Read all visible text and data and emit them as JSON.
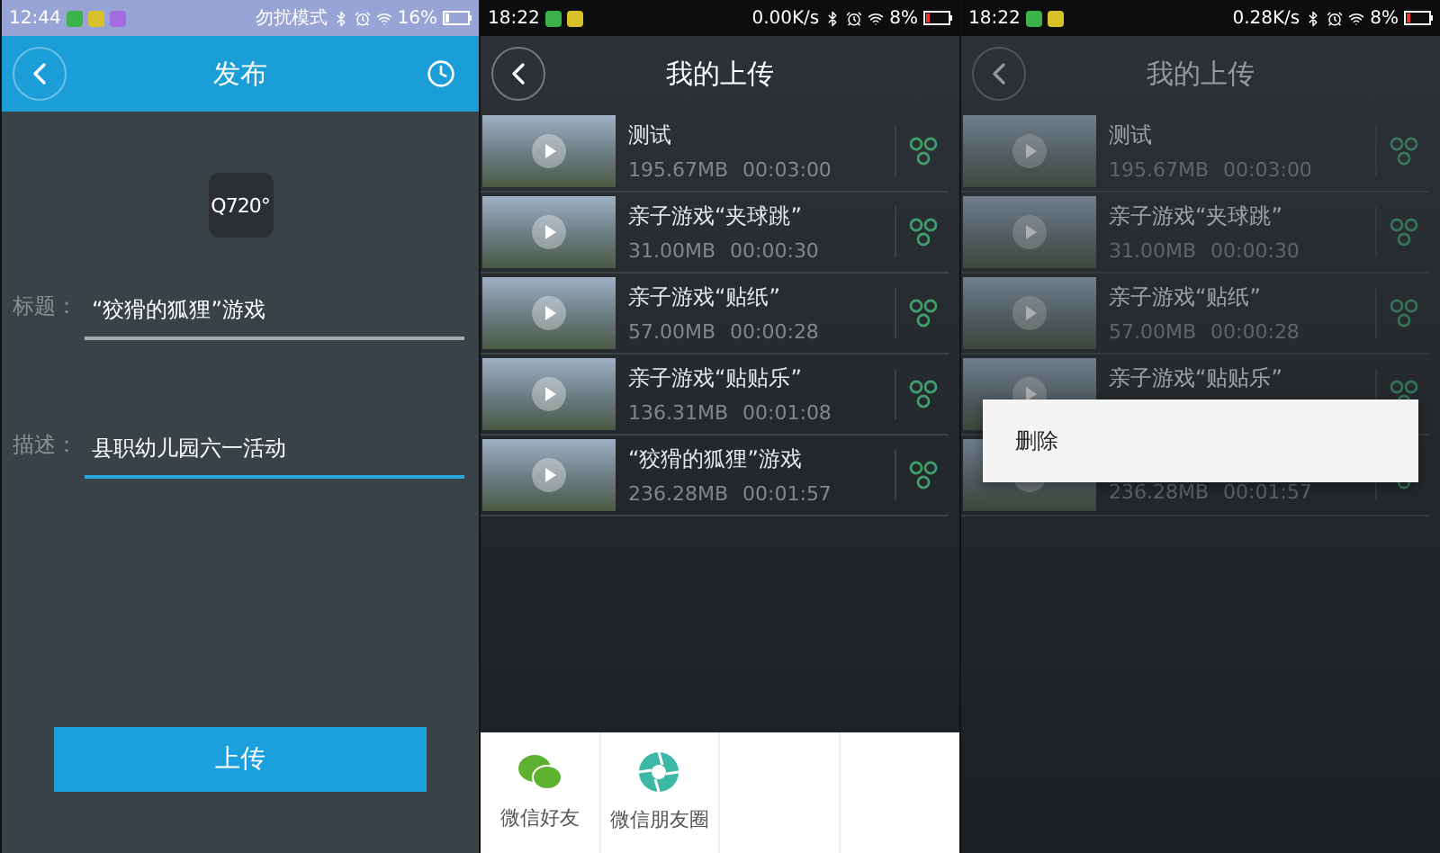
{
  "screens": [
    {
      "kind": "publish",
      "dimmed": false,
      "status_bar": {
        "time": "12:44",
        "mode_text": "勿扰模式",
        "battery": "16%"
      },
      "header": {
        "title": "发布"
      },
      "logo": {
        "text": "Q720°"
      },
      "fields": [
        {
          "label": "标题：",
          "value": "“狡猾的狐狸”游戏",
          "focused": false
        },
        {
          "label": "描述：",
          "value": "县职幼儿园六一活动",
          "focused": true
        }
      ],
      "button": "上传"
    },
    {
      "kind": "uploads",
      "dimmed": false,
      "status_bar": {
        "time": "18:22",
        "speed": "0.00K/s",
        "battery": "8%"
      },
      "header": {
        "title": "我的上传"
      },
      "videos": [
        {
          "title": "测试",
          "size": "195.67MB",
          "duration": "00:03:00"
        },
        {
          "title": "亲子游戏“夹球跳”",
          "size": "31.00MB",
          "duration": "00:00:30"
        },
        {
          "title": "亲子游戏“贴纸”",
          "size": "57.00MB",
          "duration": "00:00:28"
        },
        {
          "title": "亲子游戏“贴贴乐”",
          "size": "136.31MB",
          "duration": "00:01:08"
        },
        {
          "title": "“狡猾的狐狸”游戏",
          "size": "236.28MB",
          "duration": "00:01:57"
        }
      ],
      "share_sheet": [
        {
          "kind": "wechat",
          "label": "微信好友"
        },
        {
          "kind": "moments",
          "label": "微信朋友圈"
        },
        {
          "kind": "empty"
        },
        {
          "kind": "empty"
        }
      ]
    },
    {
      "kind": "uploads",
      "dimmed": true,
      "status_bar": {
        "time": "18:22",
        "speed": "0.28K/s",
        "battery": "8%"
      },
      "header": {
        "title": "我的上传"
      },
      "videos": [
        {
          "title": "测试",
          "size": "195.67MB",
          "duration": "00:03:00"
        },
        {
          "title": "亲子游戏“夹球跳”",
          "size": "31.00MB",
          "duration": "00:00:30"
        },
        {
          "title": "亲子游戏“贴纸”",
          "size": "57.00MB",
          "duration": "00:00:28"
        },
        {
          "title": "亲子游戏“贴贴乐”"
        },
        {
          "size": "236.28MB",
          "duration": "00:01:57"
        }
      ],
      "context_menu": [
        "删除"
      ]
    }
  ]
}
